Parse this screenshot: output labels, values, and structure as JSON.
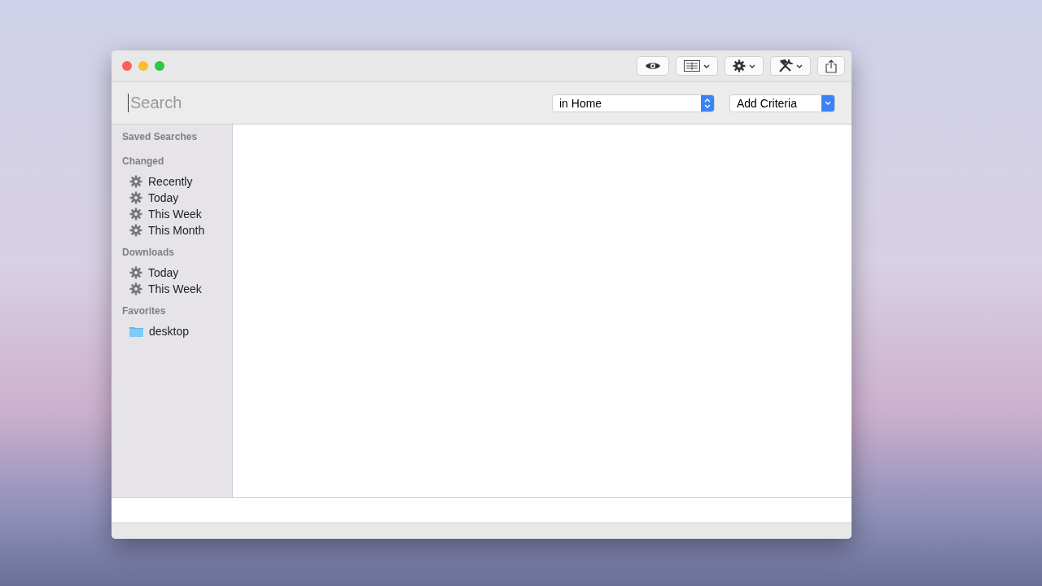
{
  "toolbar": [
    {
      "kind": "eye",
      "menu": false
    },
    {
      "kind": "view",
      "menu": true
    },
    {
      "kind": "gear",
      "menu": true
    },
    {
      "kind": "tools",
      "menu": true
    },
    {
      "kind": "share",
      "menu": false
    }
  ],
  "search": {
    "placeholder": "Search"
  },
  "scope": {
    "kind": "popup",
    "value": "in Home"
  },
  "criteria": {
    "kind": "pulldown",
    "value": "Add Criteria"
  },
  "sidebar": {
    "heading": "Saved Searches",
    "sections": [
      {
        "title": "Changed",
        "items": [
          {
            "kind": "search",
            "label": "Recently"
          },
          {
            "kind": "search",
            "label": "Today"
          },
          {
            "kind": "search",
            "label": "This Week"
          },
          {
            "kind": "search",
            "label": "This Month"
          }
        ]
      },
      {
        "title": "Downloads",
        "items": [
          {
            "kind": "search",
            "label": "Today"
          },
          {
            "kind": "search",
            "label": "This Week"
          }
        ]
      },
      {
        "title": "Favorites",
        "items": [
          {
            "kind": "folder",
            "label": "desktop"
          }
        ]
      }
    ]
  }
}
